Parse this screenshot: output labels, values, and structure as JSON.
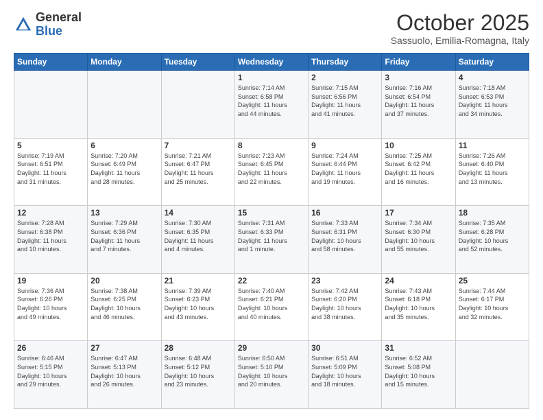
{
  "logo": {
    "general": "General",
    "blue": "Blue"
  },
  "header": {
    "month": "October 2025",
    "subtitle": "Sassuolo, Emilia-Romagna, Italy"
  },
  "days_of_week": [
    "Sunday",
    "Monday",
    "Tuesday",
    "Wednesday",
    "Thursday",
    "Friday",
    "Saturday"
  ],
  "weeks": [
    [
      {
        "day": "",
        "info": ""
      },
      {
        "day": "",
        "info": ""
      },
      {
        "day": "",
        "info": ""
      },
      {
        "day": "1",
        "info": "Sunrise: 7:14 AM\nSunset: 6:58 PM\nDaylight: 11 hours\nand 44 minutes."
      },
      {
        "day": "2",
        "info": "Sunrise: 7:15 AM\nSunset: 6:56 PM\nDaylight: 11 hours\nand 41 minutes."
      },
      {
        "day": "3",
        "info": "Sunrise: 7:16 AM\nSunset: 6:54 PM\nDaylight: 11 hours\nand 37 minutes."
      },
      {
        "day": "4",
        "info": "Sunrise: 7:18 AM\nSunset: 6:53 PM\nDaylight: 11 hours\nand 34 minutes."
      }
    ],
    [
      {
        "day": "5",
        "info": "Sunrise: 7:19 AM\nSunset: 6:51 PM\nDaylight: 11 hours\nand 31 minutes."
      },
      {
        "day": "6",
        "info": "Sunrise: 7:20 AM\nSunset: 6:49 PM\nDaylight: 11 hours\nand 28 minutes."
      },
      {
        "day": "7",
        "info": "Sunrise: 7:21 AM\nSunset: 6:47 PM\nDaylight: 11 hours\nand 25 minutes."
      },
      {
        "day": "8",
        "info": "Sunrise: 7:23 AM\nSunset: 6:45 PM\nDaylight: 11 hours\nand 22 minutes."
      },
      {
        "day": "9",
        "info": "Sunrise: 7:24 AM\nSunset: 6:44 PM\nDaylight: 11 hours\nand 19 minutes."
      },
      {
        "day": "10",
        "info": "Sunrise: 7:25 AM\nSunset: 6:42 PM\nDaylight: 11 hours\nand 16 minutes."
      },
      {
        "day": "11",
        "info": "Sunrise: 7:26 AM\nSunset: 6:40 PM\nDaylight: 11 hours\nand 13 minutes."
      }
    ],
    [
      {
        "day": "12",
        "info": "Sunrise: 7:28 AM\nSunset: 6:38 PM\nDaylight: 11 hours\nand 10 minutes."
      },
      {
        "day": "13",
        "info": "Sunrise: 7:29 AM\nSunset: 6:36 PM\nDaylight: 11 hours\nand 7 minutes."
      },
      {
        "day": "14",
        "info": "Sunrise: 7:30 AM\nSunset: 6:35 PM\nDaylight: 11 hours\nand 4 minutes."
      },
      {
        "day": "15",
        "info": "Sunrise: 7:31 AM\nSunset: 6:33 PM\nDaylight: 11 hours\nand 1 minute."
      },
      {
        "day": "16",
        "info": "Sunrise: 7:33 AM\nSunset: 6:31 PM\nDaylight: 10 hours\nand 58 minutes."
      },
      {
        "day": "17",
        "info": "Sunrise: 7:34 AM\nSunset: 6:30 PM\nDaylight: 10 hours\nand 55 minutes."
      },
      {
        "day": "18",
        "info": "Sunrise: 7:35 AM\nSunset: 6:28 PM\nDaylight: 10 hours\nand 52 minutes."
      }
    ],
    [
      {
        "day": "19",
        "info": "Sunrise: 7:36 AM\nSunset: 6:26 PM\nDaylight: 10 hours\nand 49 minutes."
      },
      {
        "day": "20",
        "info": "Sunrise: 7:38 AM\nSunset: 6:25 PM\nDaylight: 10 hours\nand 46 minutes."
      },
      {
        "day": "21",
        "info": "Sunrise: 7:39 AM\nSunset: 6:23 PM\nDaylight: 10 hours\nand 43 minutes."
      },
      {
        "day": "22",
        "info": "Sunrise: 7:40 AM\nSunset: 6:21 PM\nDaylight: 10 hours\nand 40 minutes."
      },
      {
        "day": "23",
        "info": "Sunrise: 7:42 AM\nSunset: 6:20 PM\nDaylight: 10 hours\nand 38 minutes."
      },
      {
        "day": "24",
        "info": "Sunrise: 7:43 AM\nSunset: 6:18 PM\nDaylight: 10 hours\nand 35 minutes."
      },
      {
        "day": "25",
        "info": "Sunrise: 7:44 AM\nSunset: 6:17 PM\nDaylight: 10 hours\nand 32 minutes."
      }
    ],
    [
      {
        "day": "26",
        "info": "Sunrise: 6:46 AM\nSunset: 5:15 PM\nDaylight: 10 hours\nand 29 minutes."
      },
      {
        "day": "27",
        "info": "Sunrise: 6:47 AM\nSunset: 5:13 PM\nDaylight: 10 hours\nand 26 minutes."
      },
      {
        "day": "28",
        "info": "Sunrise: 6:48 AM\nSunset: 5:12 PM\nDaylight: 10 hours\nand 23 minutes."
      },
      {
        "day": "29",
        "info": "Sunrise: 6:50 AM\nSunset: 5:10 PM\nDaylight: 10 hours\nand 20 minutes."
      },
      {
        "day": "30",
        "info": "Sunrise: 6:51 AM\nSunset: 5:09 PM\nDaylight: 10 hours\nand 18 minutes."
      },
      {
        "day": "31",
        "info": "Sunrise: 6:52 AM\nSunset: 5:08 PM\nDaylight: 10 hours\nand 15 minutes."
      },
      {
        "day": "",
        "info": ""
      }
    ]
  ]
}
